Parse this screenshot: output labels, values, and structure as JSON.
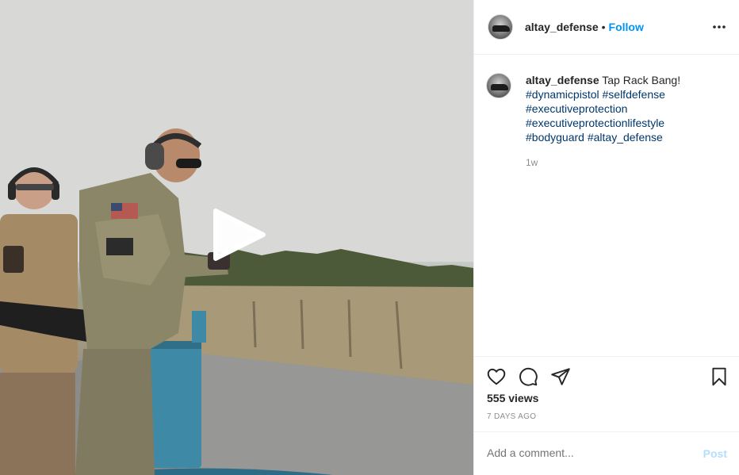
{
  "post": {
    "video": {
      "play_icon": "play-icon",
      "accessible_label": ""
    },
    "header": {
      "username": "altay_defense",
      "separator": "•",
      "follow_label": "Follow",
      "more_icon": "more-horizontal-icon"
    },
    "caption": {
      "username": "altay_defense",
      "text": "Tap Rack Bang!",
      "hashtags": [
        "#dynamicpistol",
        "#selfdefense",
        "#executiveprotection",
        "#executiveprotectionlifestyle",
        "#bodyguard",
        "#altay_defense"
      ],
      "time": "1w"
    },
    "actions": {
      "like_icon": "heart-icon",
      "comment_icon": "comment-icon",
      "share_icon": "paper-plane-icon",
      "save_icon": "bookmark-icon"
    },
    "stats": {
      "views": "555 views",
      "posted": "7 DAYS AGO"
    },
    "comment_box": {
      "placeholder": "Add a comment...",
      "post_label": "Post"
    },
    "colors": {
      "accent": "#0095f6",
      "hashtag": "#00376b",
      "post_disabled": "#b2dffc",
      "muted": "#8e8e8e"
    }
  }
}
